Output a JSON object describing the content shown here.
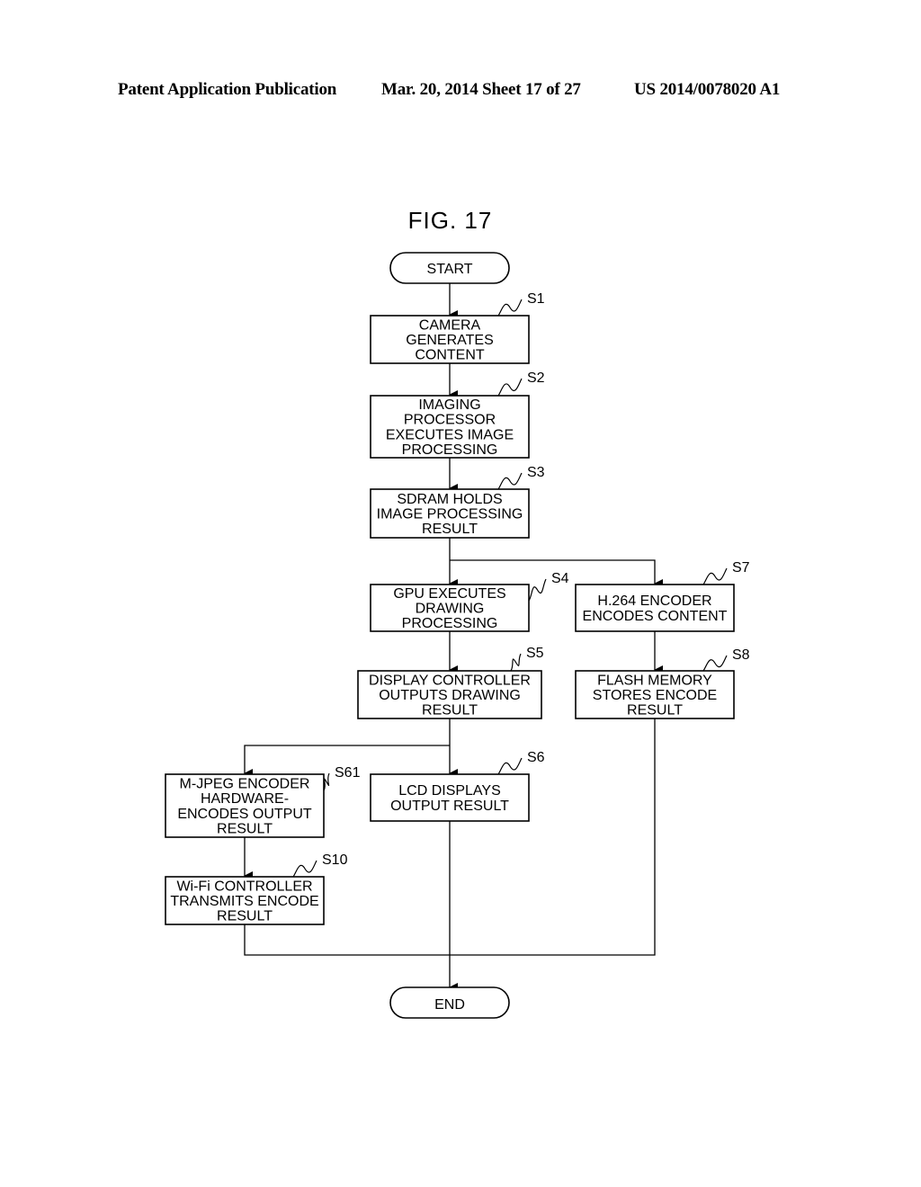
{
  "header": {
    "left": "Patent Application Publication",
    "middle": "Mar. 20, 2014  Sheet 17 of 27",
    "right": "US 2014/0078020 A1"
  },
  "figure": {
    "title": "FIG. 17",
    "terminals": {
      "start": "START",
      "end": "END"
    },
    "steps": {
      "S1": {
        "label": "S1",
        "lines": [
          "CAMERA",
          "GENERATES",
          "CONTENT"
        ]
      },
      "S2": {
        "label": "S2",
        "lines": [
          "IMAGING",
          "PROCESSOR",
          "EXECUTES IMAGE",
          "PROCESSING"
        ]
      },
      "S3": {
        "label": "S3",
        "lines": [
          "SDRAM HOLDS",
          "IMAGE PROCESSING",
          "RESULT"
        ]
      },
      "S4": {
        "label": "S4",
        "lines": [
          "GPU EXECUTES",
          "DRAWING",
          "PROCESSING"
        ]
      },
      "S5": {
        "label": "S5",
        "lines": [
          "DISPLAY CONTROLLER",
          "OUTPUTS DRAWING",
          "RESULT"
        ]
      },
      "S6": {
        "label": "S6",
        "lines": [
          "LCD DISPLAYS",
          "OUTPUT RESULT"
        ]
      },
      "S61": {
        "label": "S61",
        "lines": [
          "M-JPEG ENCODER",
          "HARDWARE-",
          "ENCODES OUTPUT",
          "RESULT"
        ]
      },
      "S10": {
        "label": "S10",
        "lines": [
          "Wi-Fi CONTROLLER",
          "TRANSMITS ENCODE",
          "RESULT"
        ]
      },
      "S7": {
        "label": "S7",
        "lines": [
          "H.264 ENCODER",
          "ENCODES CONTENT"
        ]
      },
      "S8": {
        "label": "S8",
        "lines": [
          "FLASH MEMORY",
          "STORES ENCODE",
          "RESULT"
        ]
      }
    }
  }
}
